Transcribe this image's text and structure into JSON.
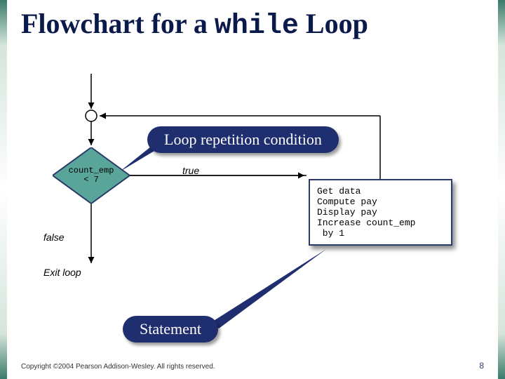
{
  "title": {
    "pre": "Flowchart for a ",
    "mono": "while",
    "post": " Loop"
  },
  "callout1": "Loop repetition condition",
  "callout2": "Statement",
  "diamond_line1": "count_emp",
  "diamond_line2": "< 7",
  "true_label": "true",
  "false_label": "false",
  "exit_label": "Exit loop",
  "process_lines": "Get data\nCompute pay\nDisplay pay\nIncrease count_emp\n by 1",
  "copyright": "Copyright ©2004 Pearson Addison-Wesley. All rights reserved.",
  "page_number": "8",
  "colors": {
    "title": "#0a1a4a",
    "callout_bg": "#1f2e6e",
    "diamond_fill": "#5aa59a",
    "stroke": "#2a3b6a"
  }
}
